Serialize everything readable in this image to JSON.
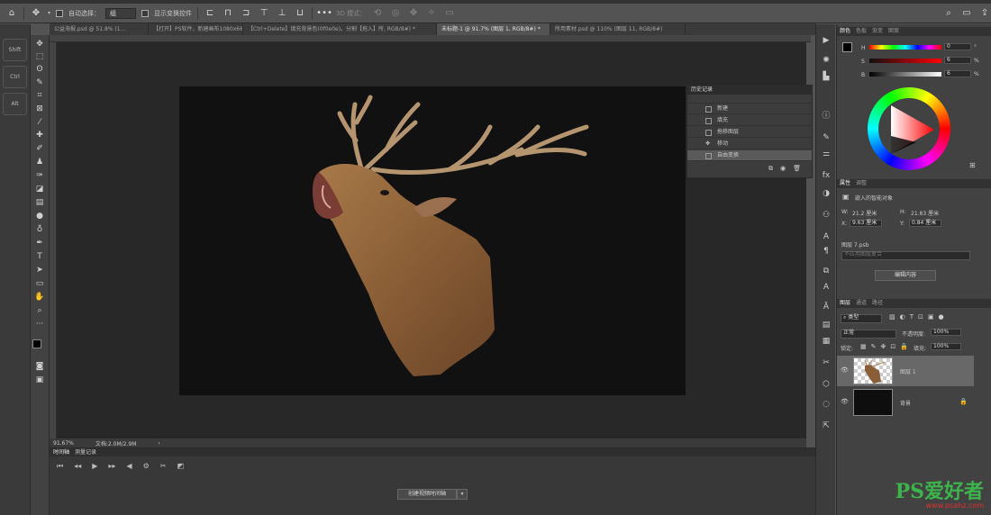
{
  "option_bar": {
    "auto_select_label": "自动选择：",
    "auto_select_target": "组",
    "show_transform_label": "显示变换控件",
    "mode_3d_label": "3D 模式："
  },
  "modifier_keys": [
    "Shift",
    "Ctrl",
    "Alt"
  ],
  "doc_tabs": [
    {
      "label": "公益海报.psd @ 51.8% (1...",
      "active": false
    },
    {
      "label": "【打开】PS软件，新建画布1080x660像素。",
      "active": false
    },
    {
      "label": "【Ctrl+Delete】填充背景色(0f0e0e)。分割【拖入】所, RGB/8#) *",
      "active": false
    },
    {
      "label": "未标题-1 @ 91.7% (图层 1, RGB/8#) *",
      "active": true
    },
    {
      "label": "所用素材.psd @ 110% (图层 11, RGB/8#)",
      "active": false
    }
  ],
  "status": {
    "zoom": "91.67%",
    "doc": "文档:2.0M/2.9M"
  },
  "timeline": {
    "tabs": [
      "时间轴",
      "测量记录"
    ],
    "create_button": "创建视频时间轴"
  },
  "history": {
    "title": "历史记录",
    "items": [
      "新建",
      "填充",
      "拖移图层",
      "移动",
      "自由变换"
    ]
  },
  "color_panel": {
    "tabs": [
      "颜色",
      "色板",
      "渐变",
      "图案"
    ],
    "h_label": "H",
    "s_label": "S",
    "b_label": "B",
    "h": "0",
    "s": "6",
    "b": "6",
    "unit": "%",
    "h_unit": "°"
  },
  "properties": {
    "tabs": [
      "属性",
      "调整"
    ],
    "type": "嵌入的智能对象",
    "w_label": "W:",
    "w": "21.2 厘米",
    "h_label": "H:",
    "h": "21.83 厘米",
    "x_label": "X:",
    "x": "9.63 厘米",
    "y_label": "Y:",
    "y": "0.84 厘米",
    "file": "图层 7.psb",
    "comp": "不应用图层复合",
    "edit_button": "编辑内容"
  },
  "layers_panel": {
    "tabs": [
      "图层",
      "通道",
      "路径"
    ],
    "filter": "类型",
    "blend": "正常",
    "opacity_label": "不透明度:",
    "opacity": "100%",
    "lock_label": "锁定:",
    "fill_label": "填充:",
    "fill": "100%",
    "layers": [
      {
        "name": "图层 1"
      },
      {
        "name": "背景"
      }
    ]
  },
  "watermark": {
    "brand": "PS爱好者",
    "url": "www.psahz.com"
  },
  "colors": {
    "canvas_bg": "#0f0e0e",
    "ui_dark": "#535353"
  }
}
